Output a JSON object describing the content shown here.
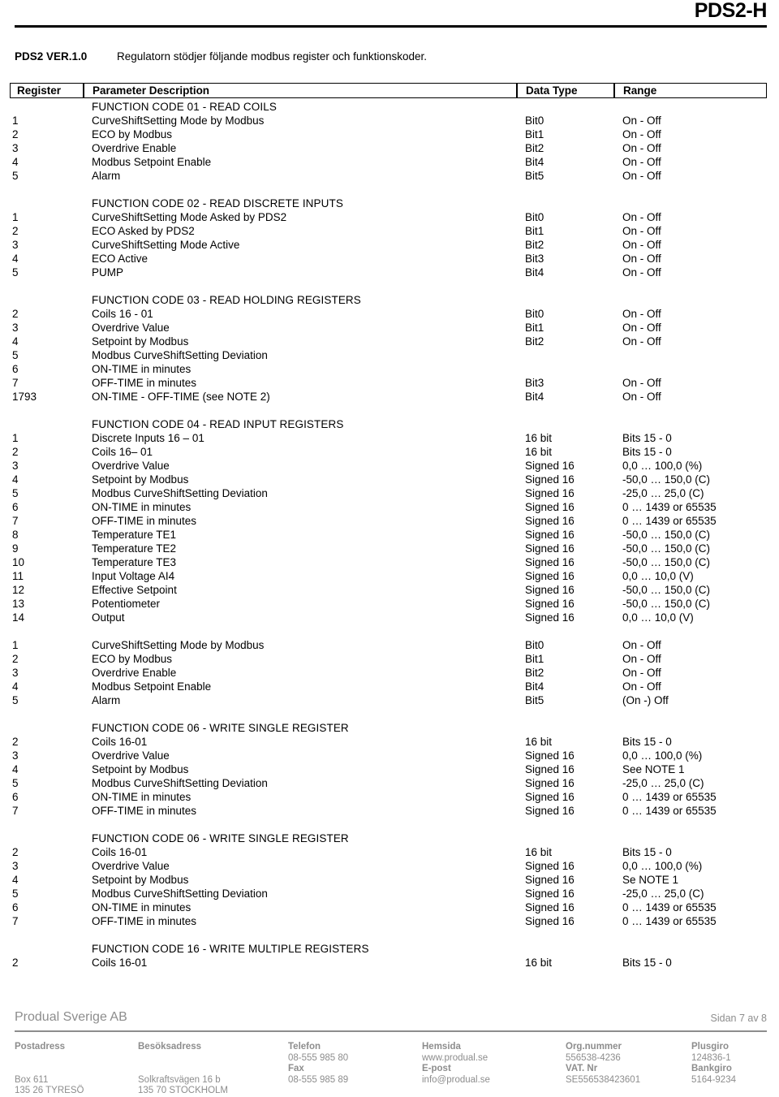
{
  "header": {
    "product_title": "PDS2-H"
  },
  "intro": {
    "version": "PDS2 VER.1.0",
    "description": "Regulatorn stödjer följande modbus register och funktionskoder."
  },
  "table": {
    "columns": {
      "register": "Register",
      "parameter_description": "Parameter Description",
      "data_type": "Data Type",
      "range": "Range"
    },
    "sections": [
      {
        "heading": "FUNCTION CODE 01 - READ COILS",
        "rows": [
          {
            "register": "1",
            "description": "CurveShiftSetting Mode by Modbus",
            "data_type": "Bit0",
            "range": "On - Off"
          },
          {
            "register": "2",
            "description": "ECO by Modbus",
            "data_type": "Bit1",
            "range": "On - Off"
          },
          {
            "register": "3",
            "description": "Overdrive Enable",
            "data_type": "Bit2",
            "range": "On - Off"
          },
          {
            "register": "4",
            "description": "Modbus Setpoint Enable",
            "data_type": "Bit4",
            "range": "On - Off"
          },
          {
            "register": "5",
            "description": "Alarm",
            "data_type": "Bit5",
            "range": "On - Off"
          }
        ]
      },
      {
        "heading": "FUNCTION CODE 02 - READ DISCRETE INPUTS",
        "rows": [
          {
            "register": "1",
            "description": "CurveShiftSetting Mode Asked by PDS2",
            "data_type": "Bit0",
            "range": "On - Off"
          },
          {
            "register": "2",
            "description": "ECO Asked by PDS2",
            "data_type": "Bit1",
            "range": "On - Off"
          },
          {
            "register": "3",
            "description": "CurveShiftSetting Mode Active",
            "data_type": "Bit2",
            "range": "On - Off"
          },
          {
            "register": "4",
            "description": "ECO Active",
            "data_type": "Bit3",
            "range": "On - Off"
          },
          {
            "register": "5",
            "description": "PUMP",
            "data_type": "Bit4",
            "range": "On - Off"
          }
        ]
      },
      {
        "heading": "FUNCTION CODE 03 - READ HOLDING REGISTERS",
        "rows": [
          {
            "register": "2",
            "description": "Coils 16 - 01",
            "data_type": "Bit0",
            "range": "On - Off"
          },
          {
            "register": "3",
            "description": "Overdrive Value",
            "data_type": "Bit1",
            "range": "On - Off"
          },
          {
            "register": "4",
            "description": "Setpoint by Modbus",
            "data_type": "Bit2",
            "range": "On - Off"
          },
          {
            "register": "5",
            "description": "Modbus CurveShiftSetting Deviation",
            "data_type": "",
            "range": ""
          },
          {
            "register": "6",
            "description": "ON-TIME in minutes",
            "data_type": "",
            "range": ""
          },
          {
            "register": "7",
            "description": "OFF-TIME in minutes",
            "data_type": "Bit3",
            "range": "On - Off"
          },
          {
            "register": "1793",
            "description": "ON-TIME - OFF-TIME (see NOTE 2)",
            "data_type": "Bit4",
            "range": "On - Off"
          }
        ]
      },
      {
        "heading": "FUNCTION CODE 04 - READ INPUT REGISTERS",
        "rows": [
          {
            "register": "1",
            "description": "Discrete Inputs 16 – 01",
            "data_type": "16 bit",
            "range": "Bits 15 - 0"
          },
          {
            "register": "2",
            "description": "Coils 16– 01",
            "data_type": "16 bit",
            "range": "Bits 15 - 0"
          },
          {
            "register": "3",
            "description": "Overdrive Value",
            "data_type": "Signed 16",
            "range": "0,0 … 100,0 (%)"
          },
          {
            "register": "4",
            "description": "Setpoint by Modbus",
            "data_type": "Signed 16",
            "range": "-50,0 … 150,0 (C)"
          },
          {
            "register": "5",
            "description": "Modbus CurveShiftSetting Deviation",
            "data_type": "Signed 16",
            "range": "-25,0 … 25,0 (C)"
          },
          {
            "register": "6",
            "description": "ON-TIME in minutes",
            "data_type": "Signed 16",
            "range": "0 … 1439 or 65535"
          },
          {
            "register": "7",
            "description": "OFF-TIME in minutes",
            "data_type": "Signed 16",
            "range": "0 … 1439 or 65535"
          },
          {
            "register": "8",
            "description": "Temperature TE1",
            "data_type": "Signed 16",
            "range": "-50,0 … 150,0 (C)"
          },
          {
            "register": "9",
            "description": "Temperature TE2",
            "data_type": "Signed 16",
            "range": "-50,0 … 150,0 (C)"
          },
          {
            "register": "10",
            "description": "Temperature TE3",
            "data_type": "Signed 16",
            "range": "-50,0 … 150,0 (C)"
          },
          {
            "register": "11",
            "description": "Input Voltage AI4",
            "data_type": "Signed 16",
            "range": "0,0 … 10,0 (V)"
          },
          {
            "register": "12",
            "description": "Effective Setpoint",
            "data_type": "Signed 16",
            "range": "-50,0 … 150,0 (C)"
          },
          {
            "register": "13",
            "description": "Potentiometer",
            "data_type": "Signed 16",
            "range": "-50,0 … 150,0 (C)"
          },
          {
            "register": "14",
            "description": "Output",
            "data_type": "Signed 16",
            "range": "0,0 … 10,0 (V)"
          }
        ]
      },
      {
        "heading": "",
        "rows": [
          {
            "register": "1",
            "description": "CurveShiftSetting Mode by Modbus",
            "data_type": "Bit0",
            "range": "On - Off"
          },
          {
            "register": "2",
            "description": "ECO by Modbus",
            "data_type": "Bit1",
            "range": "On - Off"
          },
          {
            "register": "3",
            "description": "Overdrive Enable",
            "data_type": "Bit2",
            "range": "On - Off"
          },
          {
            "register": "4",
            "description": "Modbus Setpoint Enable",
            "data_type": "Bit4",
            "range": "On - Off"
          },
          {
            "register": "5",
            "description": "Alarm",
            "data_type": "Bit5",
            "range": "(On -) Off"
          }
        ]
      },
      {
        "heading": "FUNCTION CODE 06 - WRITE SINGLE REGISTER",
        "rows": [
          {
            "register": "2",
            "description": "Coils 16-01",
            "data_type": "16 bit",
            "range": "Bits 15 - 0"
          },
          {
            "register": "3",
            "description": "Overdrive Value",
            "data_type": "Signed 16",
            "range": "0,0 … 100,0 (%)"
          },
          {
            "register": "4",
            "description": "Setpoint by Modbus",
            "data_type": "Signed 16",
            "range": "See NOTE 1"
          },
          {
            "register": "5",
            "description": "Modbus CurveShiftSetting Deviation",
            "data_type": "Signed 16",
            "range": "-25,0 … 25,0 (C)"
          },
          {
            "register": "6",
            "description": "ON-TIME in minutes",
            "data_type": "Signed 16",
            "range": "0 … 1439 or 65535"
          },
          {
            "register": "7",
            "description": "OFF-TIME in minutes",
            "data_type": "Signed 16",
            "range": "0 … 1439 or 65535"
          }
        ]
      },
      {
        "heading": "FUNCTION CODE 06 - WRITE SINGLE REGISTER",
        "rows": [
          {
            "register": "2",
            "description": "Coils 16-01",
            "data_type": "16 bit",
            "range": "Bits 15 - 0"
          },
          {
            "register": "3",
            "description": "Overdrive Value",
            "data_type": "Signed 16",
            "range": "0,0 … 100,0 (%)"
          },
          {
            "register": "4",
            "description": "Setpoint by Modbus",
            "data_type": "Signed 16",
            "range": "Se NOTE 1"
          },
          {
            "register": "5",
            "description": "Modbus CurveShiftSetting Deviation",
            "data_type": "Signed 16",
            "range": "-25,0 … 25,0 (C)"
          },
          {
            "register": "6",
            "description": "ON-TIME in minutes",
            "data_type": "Signed 16",
            "range": "0 … 1439 or 65535"
          },
          {
            "register": "7",
            "description": "OFF-TIME in minutes",
            "data_type": "Signed 16",
            "range": "0 … 1439 or 65535"
          }
        ]
      },
      {
        "heading": "FUNCTION CODE 16 - WRITE MULTIPLE REGISTERS",
        "rows": [
          {
            "register": "2",
            "description": "Coils 16-01",
            "data_type": "16 bit",
            "range": "Bits 15 - 0"
          }
        ]
      }
    ]
  },
  "footer": {
    "company": "Produal Sverige AB",
    "page": "Sidan 7 av 8",
    "columns": [
      {
        "label1": "Postadress",
        "value1": "",
        "label2": "",
        "value2": "Box 611",
        "value3": "135 26  TYRESÖ"
      },
      {
        "label1": "Besöksadress",
        "value1": "",
        "label2": "",
        "value2": "Solkraftsvägen 16 b",
        "value3": "135 70  STOCKHOLM"
      },
      {
        "label1": "Telefon",
        "value1": "08-555 985 80",
        "label2": "Fax",
        "value2": "08-555 985 89",
        "value3": ""
      },
      {
        "label1": "Hemsida",
        "value1": "www.produal.se",
        "label2": "E-post",
        "value2": "info@produal.se",
        "value3": ""
      },
      {
        "label1": "Org.nummer",
        "value1": "556538-4236",
        "label2": "VAT. Nr",
        "value2": "SE556538423601",
        "value3": ""
      },
      {
        "label1": "Plusgiro",
        "value1": "124836-1",
        "label2": "Bankgiro",
        "value2": "5164-9234",
        "value3": ""
      }
    ]
  },
  "colors": {
    "ink": "#000000",
    "footer_gray": "#8d8d8d",
    "page_background": "#ffffff"
  }
}
